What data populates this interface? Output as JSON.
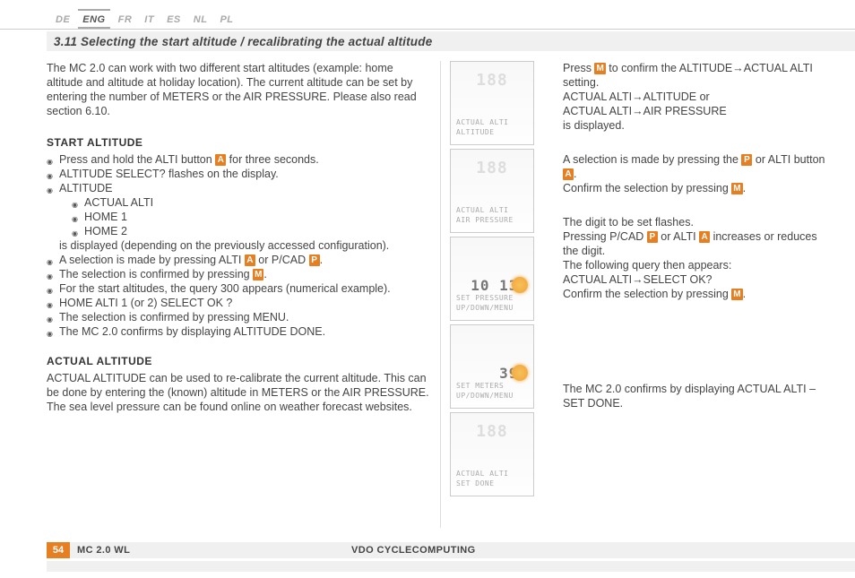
{
  "languages": [
    "DE",
    "ENG",
    "FR",
    "IT",
    "ES",
    "NL",
    "PL"
  ],
  "active_lang_index": 1,
  "section_title": "3.11 Selecting the start altitude / recalibrating the actual altitude",
  "intro": "The MC 2.0 can work with two different start altitudes (example: home altitude and altitude at holiday location). The current altitude can be set by entering the number of METERS or the AIR PRESSURE. Please also read section 6.10.",
  "start_heading": "START ALTITUDE",
  "start": {
    "l1a": "Press and hold the ALTI button ",
    "l1b": " for three seconds.",
    "l2": "ALTITUDE SELECT? flashes on the display.",
    "l3": "ALTITUDE",
    "s1": "ACTUAL ALTI",
    "s2": "HOME 1",
    "s3": "HOME 2",
    "l3_trail": "is displayed (depending on the previously accessed configuration).",
    "l4a": "A selection is made by pressing ALTI ",
    "l4b": " or P/CAD ",
    "l4c": ".",
    "l5a": "The selection is confirmed by pressing ",
    "l5b": ".",
    "l6": "For the start altitudes, the query 300 appears (numerical example).",
    "l7": "HOME ALTI 1 (or 2) SELECT OK ?",
    "l8": "The selection is confirmed by pressing MENU.",
    "l9": "The MC 2.0 confirms by displaying ALTITUDE DONE."
  },
  "actual_heading": "ACTUAL ALTITUDE",
  "actual_text": "ACTUAL ALTITUDE can be used to re-calibrate the current altitude. This can be done by entering the (known) altitude in METERS or the AIR PRESSURE. The sea level pressure can be found online on weather forecast websites.",
  "chips": {
    "A": "A",
    "P": "P",
    "M": "M"
  },
  "devices": [
    {
      "val": "",
      "lbl1": "ACTUAL ALTI",
      "lbl2": "ALTITUDE",
      "sun": false
    },
    {
      "val": "",
      "lbl1": "ACTUAL ALTI",
      "lbl2": "AIR PRESSURE",
      "sun": false
    },
    {
      "val": "10 132",
      "lbl1": "SET PRESSURE",
      "lbl2": "UP/DOWN/MENU",
      "sun": true
    },
    {
      "val": "398",
      "lbl1": "SET METERS",
      "lbl2": "UP/DOWN/MENU",
      "sun": true
    },
    {
      "val": "",
      "lbl1": "ACTUAL ALTI",
      "lbl2": "SET DONE",
      "sun": false
    }
  ],
  "right": {
    "b1a": "Press ",
    "b1b": " to confirm the ALTITUDE→ACTUAL ALTI setting.",
    "b1c": "ACTUAL ALTI→ALTITUDE or",
    "b1d": "ACTUAL ALTI→AIR PRESSURE",
    "b1e": "is displayed.",
    "b2a": "A selection is made by pressing the ",
    "b2b": " or ALTI button ",
    "b2c": ".",
    "b2d": "Confirm the selection by pressing ",
    "b2e": ".",
    "b3a": "The digit to be set flashes.",
    "b3b": "Pressing P/CAD ",
    "b3c": " or ALTI ",
    "b3d": " increases or reduces the digit.",
    "b3e": "The following query then appears:",
    "b3f": "ACTUAL ALTI→SELECT OK?",
    "b3g": "Confirm the selection by pressing ",
    "b3h": ".",
    "b4": "The MC 2.0 confirms by displaying ACTUAL ALTI – SET DONE."
  },
  "footer": {
    "page": "54",
    "model": "MC 2.0 WL",
    "brand": "VDO CYCLECOMPUTING"
  }
}
